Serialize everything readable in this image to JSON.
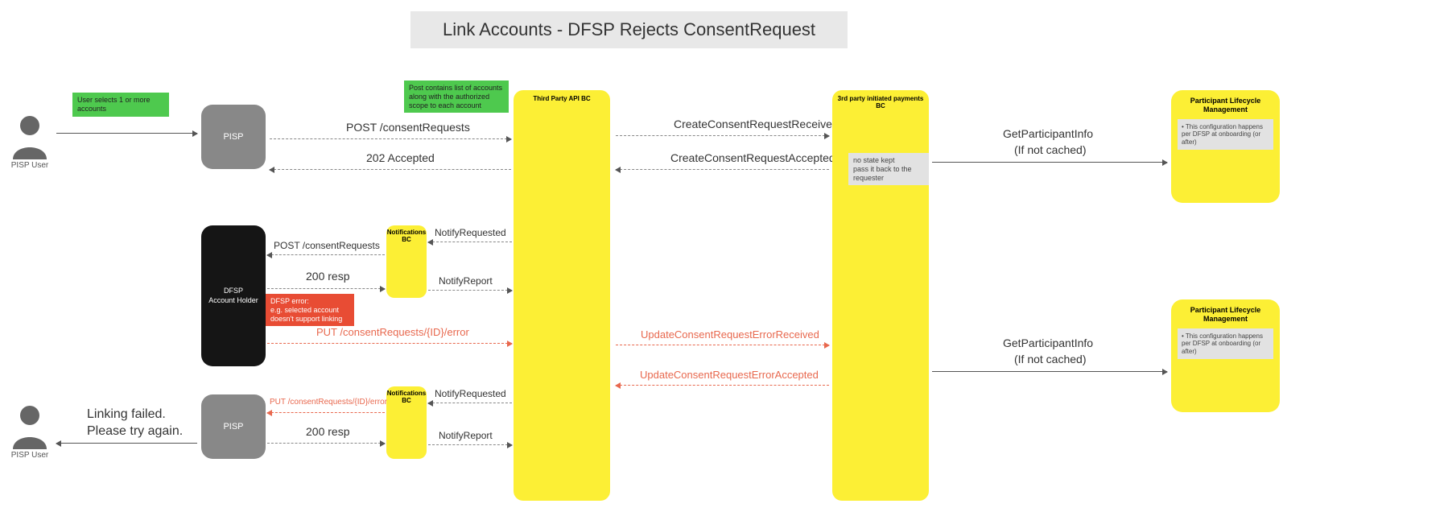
{
  "title": "Link Accounts - DFSP Rejects ConsentRequest",
  "actors": {
    "pisp_user": "PISP User"
  },
  "notes": {
    "user_selects": "User selects 1 or more accounts",
    "post_contains": "Post contains list of accounts along with the authorized scope to each account",
    "dfsp_error": "DFSP error:\ne.g. selected account doesn't support linking",
    "no_state": "no state kept\npass it back to the requester",
    "plm_note": "This configuration happens per DFSP at onboarding (or after)"
  },
  "boxes": {
    "pisp": "PISP",
    "dfsp": "DFSP\nAccount Holder",
    "notifications_bc": "Notifications BC",
    "third_party_api_bc": "Third Party API BC",
    "third_party_payments_bc": "3rd party initiated payments BC",
    "plm": "Participant Lifecycle Management"
  },
  "messages": {
    "post_consent": "POST /consentRequests",
    "accepted_202": "202 Accepted",
    "create_received": "CreateConsentRequestReceived",
    "create_accepted": "CreateConsentRequestAccepted",
    "get_participant": "GetParticipantInfo",
    "if_not_cached": "(If not cached)",
    "notify_requested": "NotifyRequested",
    "notify_report": "NotifyReport",
    "resp_200": "200 resp",
    "put_error": "PUT /consentRequests/{ID}/error",
    "update_err_received": "UpdateConsentRequestErrorReceived",
    "update_err_accepted": "UpdateConsentRequestErrorAccepted",
    "linking_failed": "Linking failed.\nPlease try again."
  }
}
